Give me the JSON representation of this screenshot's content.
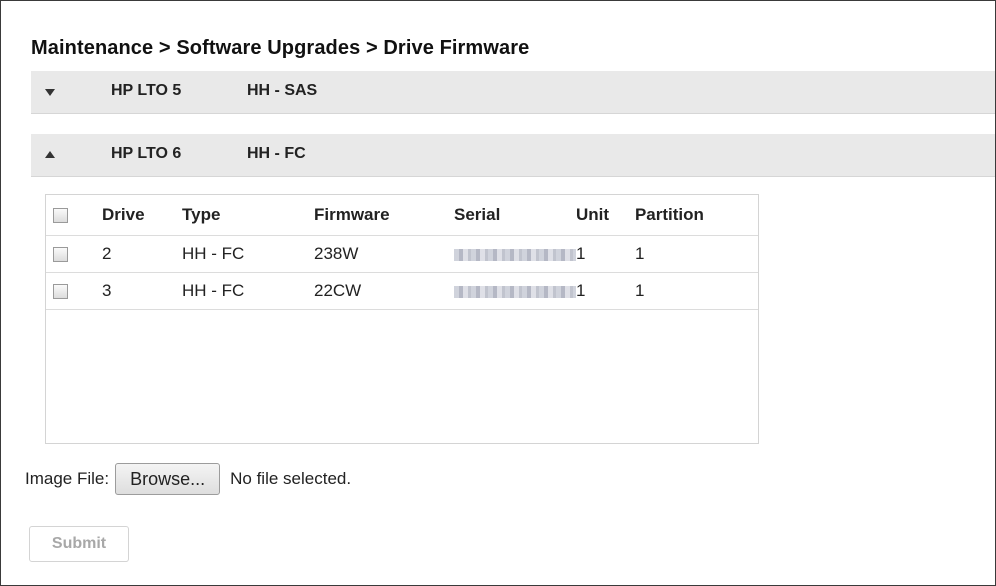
{
  "breadcrumb": "Maintenance > Software Upgrades > Drive Firmware",
  "sections": [
    {
      "model": "HP LTO 5",
      "kind": "HH - SAS",
      "expanded": false
    },
    {
      "model": "HP LTO 6",
      "kind": "HH - FC",
      "expanded": true
    }
  ],
  "table": {
    "headers": [
      "Drive",
      "Type",
      "Firmware",
      "Serial",
      "Unit",
      "Partition"
    ],
    "rows": [
      {
        "drive": "2",
        "type": "HH - FC",
        "firmware": "238W",
        "serial_redacted": true,
        "unit": "1",
        "partition": "1"
      },
      {
        "drive": "3",
        "type": "HH - FC",
        "firmware": "22CW",
        "serial_redacted": true,
        "unit": "1",
        "partition": "1"
      }
    ]
  },
  "image_file": {
    "label": "Image File:",
    "browse_label": "Browse...",
    "status": "No file selected."
  },
  "submit": {
    "label": "Submit",
    "disabled": true
  },
  "colors": {
    "section_bar": "#e9e9e9",
    "disabled_text": "#a8a8a8"
  }
}
